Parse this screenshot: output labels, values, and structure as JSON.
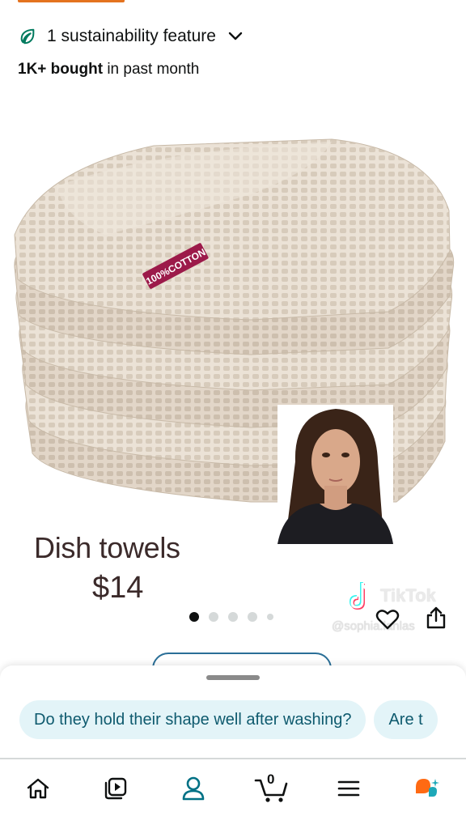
{
  "sustainability": {
    "label": "1 sustainability feature",
    "leaf_icon": "leaf-icon",
    "leaf_color": "#007a5e"
  },
  "purchases": {
    "count": "1K+ bought",
    "suffix": "in past month"
  },
  "product": {
    "image_alt": "Waffle weave dish towels stack",
    "tag_text": "100%COTTON"
  },
  "video_overlay": {
    "title": "Dish towels",
    "price": "$14",
    "tiktok_label": "TikTok",
    "tiktok_handle": "@sophia.lanlas"
  },
  "carousel": {
    "total": 5,
    "active_index": 0
  },
  "suggestions": {
    "chips": [
      "Do they hold their shape well after washing?",
      "Are t"
    ]
  },
  "bottom_nav": {
    "items": [
      "home-icon",
      "video-icon",
      "account-icon",
      "cart-icon",
      "menu-icon",
      "rufus-icon"
    ],
    "cart_count": "0",
    "active": "account-icon"
  },
  "colors": {
    "accent_orange": "#e4731f",
    "chip_bg": "#e3f4f8",
    "chip_text": "#0e5a6e",
    "nav_active": "#007185"
  }
}
